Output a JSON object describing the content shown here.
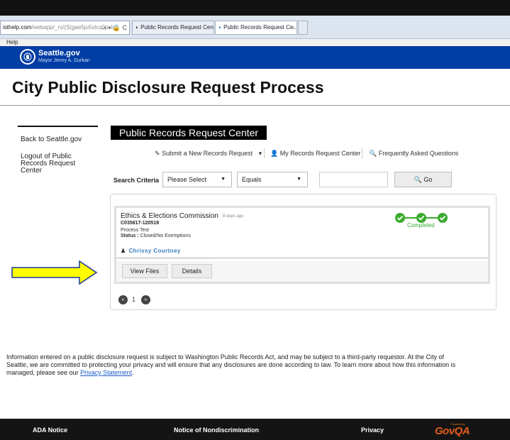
{
  "browser": {
    "address_domain": "isthelp.com",
    "address_path": "/webapp/_rs/(S(gae5ju5xlcq0pxlgs",
    "address_controls": "⌕ ▾ 🔒 C",
    "tabs": [
      {
        "label": "Public Records Request Center..."
      },
      {
        "label": "Public Records Request Ce..."
      }
    ],
    "tab_close": "×",
    "menu_help": "Help"
  },
  "site": {
    "brand": "Seattle.gov",
    "mayor": "Mayor Jenny A. Durkan",
    "page_title": "City Public Disclosure Request Process"
  },
  "sidebar": {
    "links": [
      {
        "label": "Back to Seattle.gov"
      },
      {
        "label": "Logout of Public Records Request Center"
      }
    ]
  },
  "center": {
    "title": "Public Records Request Center",
    "actions": [
      {
        "label": "Submit a New Records Request",
        "icon": "edit-icon",
        "has_caret": true
      },
      {
        "label": "My Records Request Center",
        "icon": "user-icon"
      },
      {
        "label": "Frequently Asked Questions",
        "icon": "search-icon"
      }
    ],
    "action_caret": "▾"
  },
  "search": {
    "label": "Search Criteria",
    "field_select": "Please Select",
    "operator_select": "Equals",
    "value": "",
    "go_label": "Go"
  },
  "result": {
    "department": "Ethics & Elections Commission",
    "age": "8 days ago",
    "reference": "C035817-120518",
    "description": "Process Test",
    "status_label": "Status :",
    "status_value": "Closed/No Exemptions",
    "assignee": "Chrissy Courtney",
    "progress_state": "Completed",
    "progress_steps_completed": 3,
    "progress_steps_total": 3,
    "view_files_label": "View Files",
    "details_label": "Details"
  },
  "pagination": {
    "prev": "«",
    "current_page": "1",
    "next": "»"
  },
  "notice": {
    "line1": "Information entered on a public disclosure request is subject to Washington Public Records Act, and may be subject to a third-party requestor. At the City of",
    "line2": "Seattle, we are committed to protecting your privacy and will ensure that any disclosures are done according to law. To learn more about how this information is",
    "line3_prefix": "managed, please see our ",
    "link": "Privacy Statement",
    "line3_suffix": "."
  },
  "footer": {
    "links": [
      {
        "label": "ADA Notice"
      },
      {
        "label": "Notice of Nondiscrimination"
      },
      {
        "label": "Privacy"
      }
    ],
    "logo_powered": "Powered by",
    "logo_text": "GovQA"
  },
  "colors": {
    "seattle_blue": "#003da5",
    "completed_green": "#3bab2f",
    "link_blue": "#3a7dbd",
    "arrow_yellow": "#ffff00",
    "arrow_outline": "#1a3a9a",
    "govqa_orange": "#e35d1c"
  }
}
